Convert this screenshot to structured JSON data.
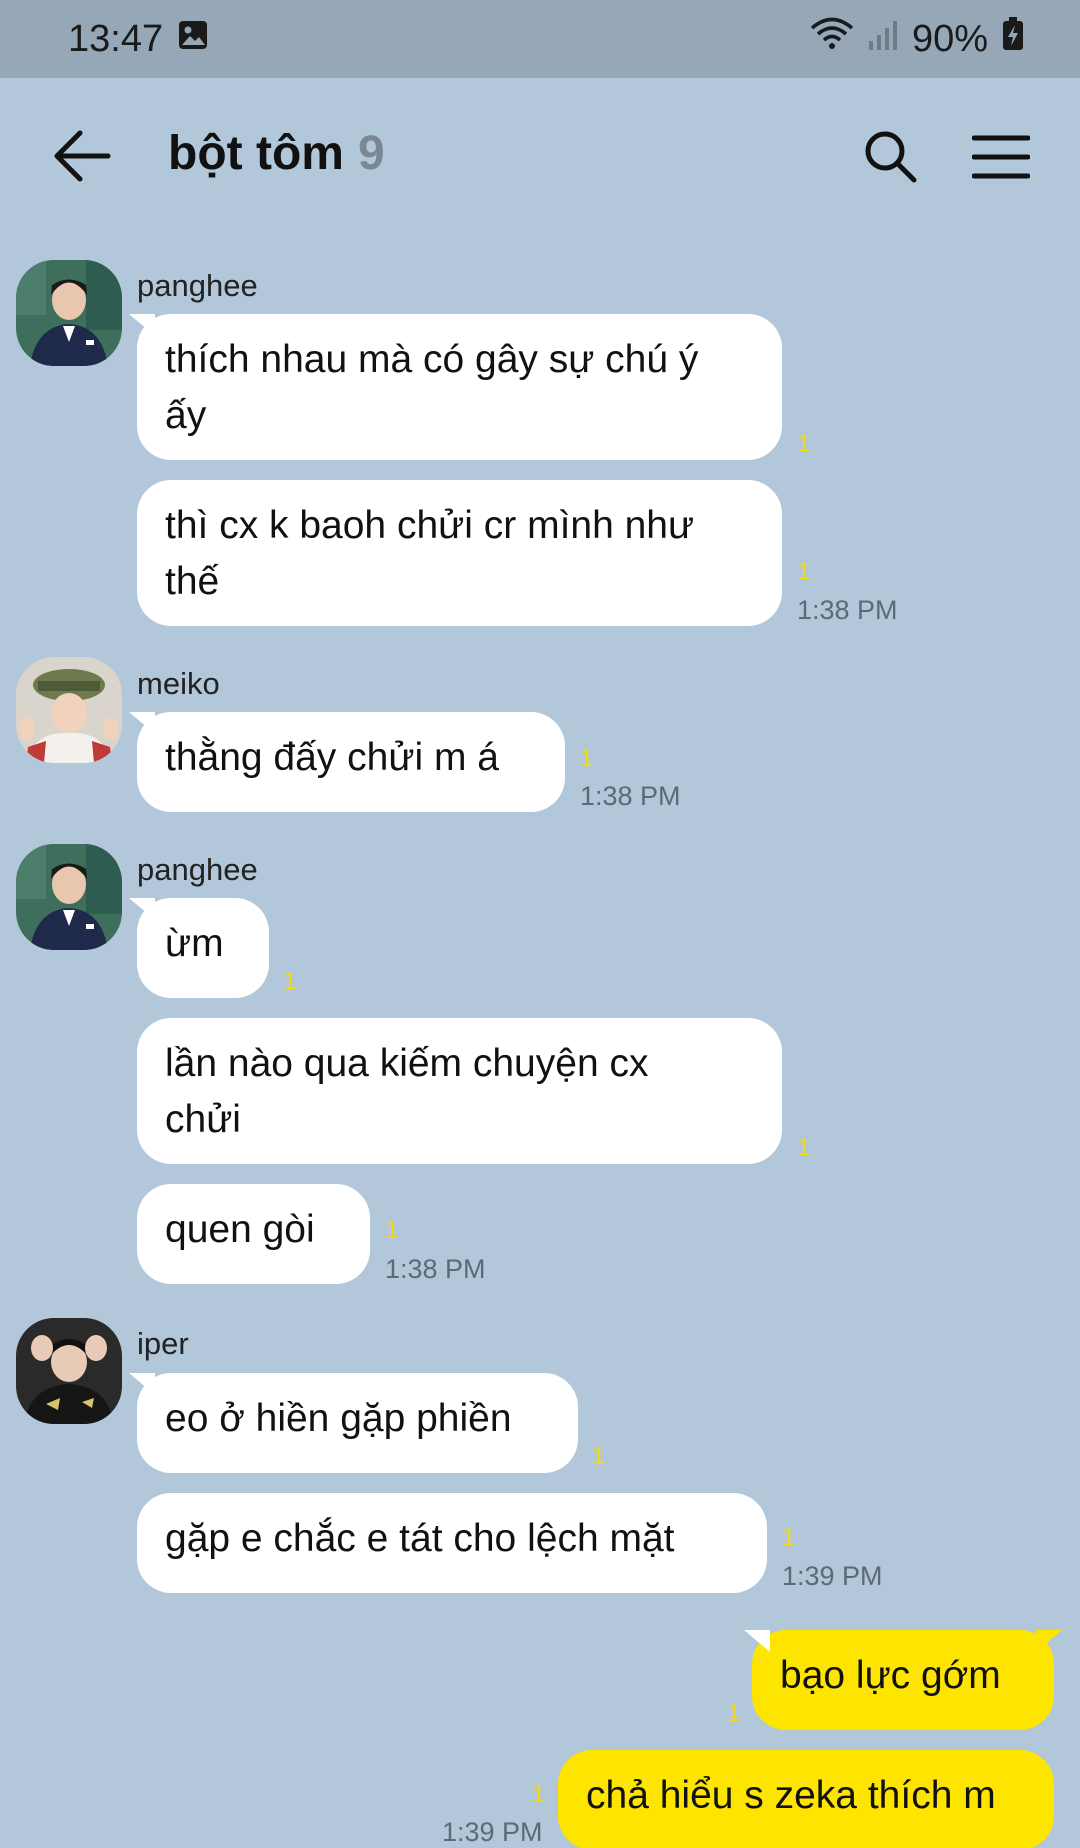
{
  "status": {
    "time": "13:47",
    "battery": "90%"
  },
  "header": {
    "title": "bột tôm",
    "member_count": "9"
  },
  "messages": [
    {
      "sender": "panghee",
      "text_lines": [
        "thích nhau mà có gây sự chú ý",
        "ấy"
      ],
      "unread": "1"
    },
    {
      "text_lines": [
        "thì cx k baoh chửi cr mình như",
        "thế"
      ],
      "unread": "1",
      "time": "1:38 PM"
    },
    {
      "sender": "meiko",
      "text": "thằng đấy chửi m á",
      "unread": "1",
      "time": "1:38 PM"
    },
    {
      "sender": "panghee",
      "text": "ừm",
      "unread": "1"
    },
    {
      "text_lines": [
        "lần nào qua kiếm chuyện cx",
        "chửi"
      ],
      "unread": "1"
    },
    {
      "text": "quen gòi",
      "unread": "1",
      "time": "1:38 PM"
    },
    {
      "sender": "iper",
      "text": "eo ở hiền gặp phiền",
      "unread": "1"
    },
    {
      "text": "gặp e chắc e tát cho lệch mặt",
      "unread": "1",
      "time": "1:39 PM"
    },
    {
      "text": "bạo lực gớm",
      "unread": "1"
    },
    {
      "text": "chả hiểu s zeka thích m",
      "unread": "1",
      "time": "1:39 PM"
    }
  ],
  "colors": {
    "background": "#b2c7d9",
    "my_bubble": "#fee500",
    "other_bubble": "#ffffff",
    "unread": "#f5d90a"
  },
  "icons": [
    "gallery-icon",
    "wifi-icon",
    "signal-icon",
    "battery-charging-icon",
    "back-arrow-icon",
    "search-icon",
    "menu-icon"
  ]
}
